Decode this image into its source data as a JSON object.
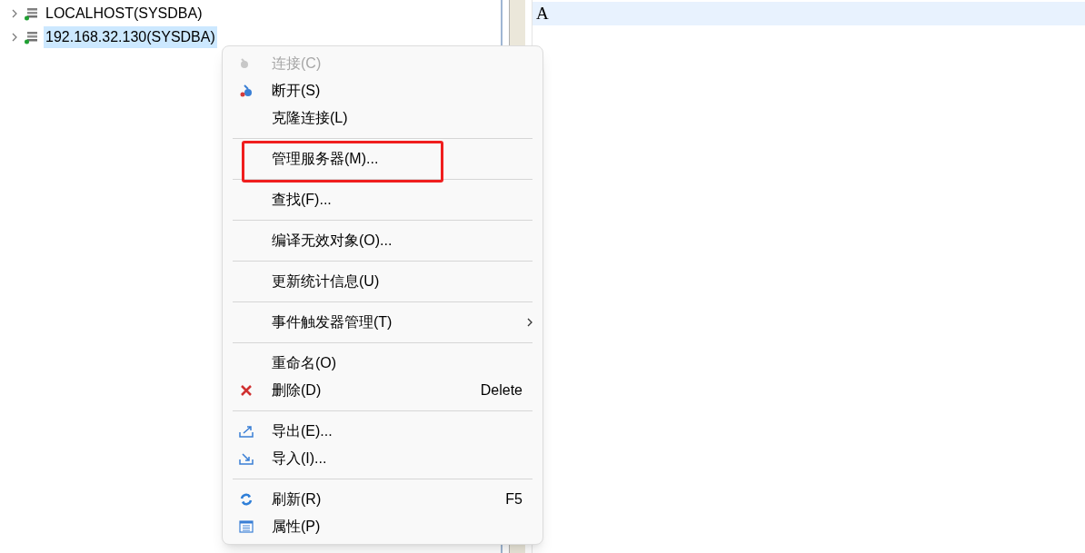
{
  "tree": {
    "items": [
      {
        "label": "LOCALHOST(SYSDBA)",
        "selected": false
      },
      {
        "label": "192.168.32.130(SYSDBA)",
        "selected": true
      }
    ]
  },
  "editor": {
    "lines": [
      "A"
    ]
  },
  "context_menu": {
    "items": [
      {
        "kind": "item",
        "label": "连接(C)",
        "disabled": true
      },
      {
        "kind": "item",
        "label": "断开(S)",
        "disabled": false
      },
      {
        "kind": "item",
        "label": "克隆连接(L)",
        "disabled": false
      },
      {
        "kind": "separator"
      },
      {
        "kind": "item",
        "label": "管理服务器(M)...",
        "disabled": false,
        "outlined": true
      },
      {
        "kind": "separator"
      },
      {
        "kind": "item",
        "label": "查找(F)...",
        "disabled": false
      },
      {
        "kind": "separator"
      },
      {
        "kind": "item",
        "label": "编译无效对象(O)...",
        "disabled": false
      },
      {
        "kind": "separator"
      },
      {
        "kind": "item",
        "label": "更新统计信息(U)",
        "disabled": false
      },
      {
        "kind": "separator"
      },
      {
        "kind": "item",
        "label": "事件触发器管理(T)",
        "disabled": false,
        "submenu": true
      },
      {
        "kind": "separator"
      },
      {
        "kind": "item",
        "label": "重命名(O)",
        "disabled": false
      },
      {
        "kind": "item",
        "label": "删除(D)",
        "shortcut": "Delete",
        "disabled": false
      },
      {
        "kind": "separator"
      },
      {
        "kind": "item",
        "label": "导出(E)...",
        "disabled": false
      },
      {
        "kind": "item",
        "label": "导入(I)...",
        "disabled": false
      },
      {
        "kind": "separator"
      },
      {
        "kind": "item",
        "label": "刷新(R)",
        "shortcut": "F5",
        "disabled": false
      },
      {
        "kind": "item",
        "label": "属性(P)",
        "disabled": false
      }
    ]
  }
}
